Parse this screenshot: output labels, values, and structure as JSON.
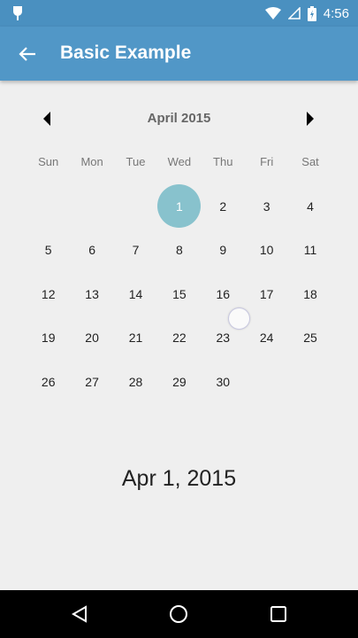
{
  "status_bar": {
    "time": "4:56",
    "icons": [
      "notification-icon",
      "wifi-icon",
      "signal-icon",
      "battery-icon"
    ]
  },
  "app_bar": {
    "title": "Basic Example",
    "back_icon": "arrow-back-icon"
  },
  "calendar": {
    "month_title": "April 2015",
    "weekdays": [
      "Sun",
      "Mon",
      "Tue",
      "Wed",
      "Thu",
      "Fri",
      "Sat"
    ],
    "weeks": [
      [
        "",
        "",
        "",
        "1",
        "2",
        "3",
        "4"
      ],
      [
        "5",
        "6",
        "7",
        "8",
        "9",
        "10",
        "11"
      ],
      [
        "12",
        "13",
        "14",
        "15",
        "16",
        "17",
        "18"
      ],
      [
        "19",
        "20",
        "21",
        "22",
        "23",
        "24",
        "25"
      ],
      [
        "26",
        "27",
        "28",
        "29",
        "30",
        "",
        ""
      ]
    ],
    "selected_day": "1",
    "selected_color": "#88c2cd"
  },
  "selected_date_text": "Apr 1, 2015",
  "colors": {
    "status_bar": "#4a90c0",
    "app_bar": "#5197c7",
    "background": "#efefef"
  }
}
